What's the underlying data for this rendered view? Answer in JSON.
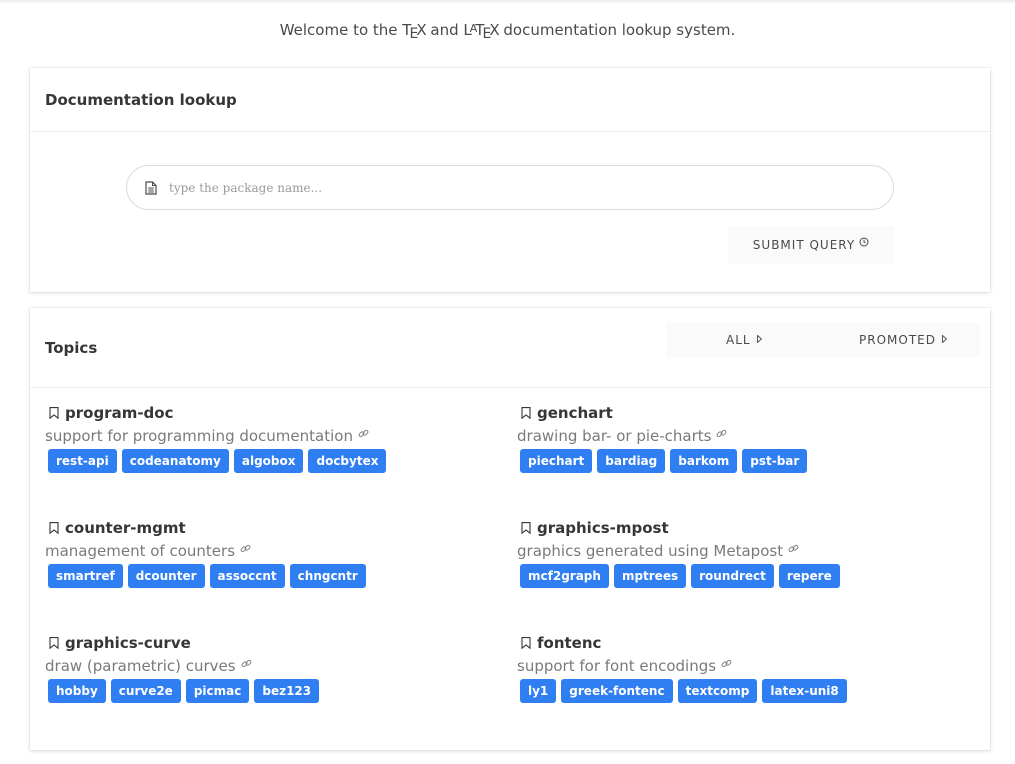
{
  "welcome": {
    "prefix": "Welcome to the",
    "and": "and",
    "suffix": "documentation lookup system."
  },
  "lookup": {
    "title": "Documentation lookup",
    "search_placeholder": "type the package name...",
    "submit_label": "SUBMIT QUERY"
  },
  "topics": {
    "title": "Topics",
    "filters": [
      "ALL",
      "PROMOTED"
    ],
    "items": [
      {
        "name": "program-doc",
        "description": "support for programming documentation",
        "tags": [
          "rest-api",
          "codeanatomy",
          "algobox",
          "docbytex"
        ]
      },
      {
        "name": "genchart",
        "description": "drawing bar- or pie-charts",
        "tags": [
          "piechart",
          "bardiag",
          "barkom",
          "pst-bar"
        ]
      },
      {
        "name": "counter-mgmt",
        "description": "management of counters",
        "tags": [
          "smartref",
          "dcounter",
          "assoccnt",
          "chngcntr"
        ]
      },
      {
        "name": "graphics-mpost",
        "description": "graphics generated using Metapost",
        "tags": [
          "mcf2graph",
          "mptrees",
          "roundrect",
          "repere"
        ]
      },
      {
        "name": "graphics-curve",
        "description": "draw (parametric) curves",
        "tags": [
          "hobby",
          "curve2e",
          "picmac",
          "bez123"
        ]
      },
      {
        "name": "fontenc",
        "description": "support for font encodings",
        "tags": [
          "ly1",
          "greek-fontenc",
          "textcomp",
          "latex-uni8"
        ]
      }
    ]
  },
  "icons": {
    "search": "document-icon",
    "submit": "clock-icon",
    "filter": "caret-right-icon",
    "topic": "bookmark-icon",
    "description": "link-icon"
  },
  "colors": {
    "tag_background": "#2f7ef2",
    "tag_text": "#ffffff"
  }
}
